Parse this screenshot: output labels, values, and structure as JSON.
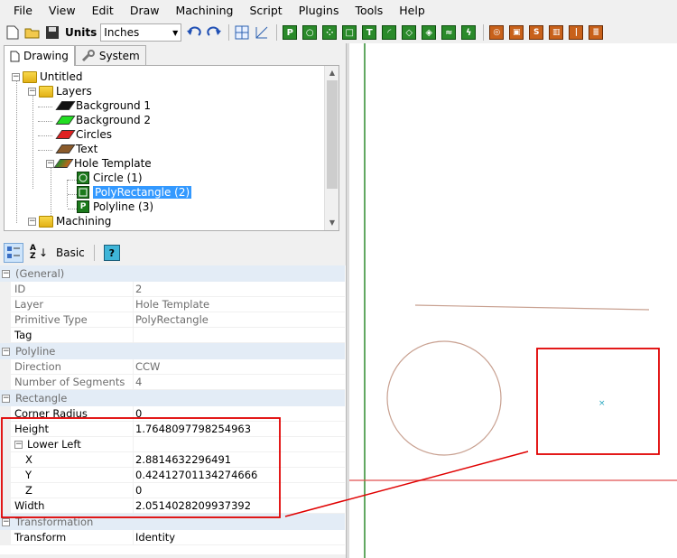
{
  "menu": [
    "File",
    "View",
    "Edit",
    "Draw",
    "Machining",
    "Script",
    "Plugins",
    "Tools",
    "Help"
  ],
  "toolbar": {
    "units_label": "Units",
    "units_value": "Inches"
  },
  "tabs": [
    {
      "label": "Drawing",
      "icon": "page-icon"
    },
    {
      "label": "System",
      "icon": "wrench-icon"
    }
  ],
  "tree": {
    "root": "Untitled",
    "layers": "Layers",
    "items": [
      "Background 1",
      "Background 2",
      "Circles",
      "Text"
    ],
    "hole_template": "Hole Template",
    "primitives": [
      "Circle (1)",
      "PolyRectangle (2)",
      "Polyline (3)"
    ],
    "machining": "Machining",
    "layer_colors": [
      "#111111",
      "#22dd22",
      "#e02020",
      "#8a5a2a"
    ]
  },
  "prop_toolbar": {
    "basic_label": "Basic",
    "help": "?",
    "sort_icon": "A Z"
  },
  "properties": {
    "general": "(General)",
    "id": {
      "name": "ID",
      "value": "2"
    },
    "layer": {
      "name": "Layer",
      "value": "Hole Template"
    },
    "primitive_type": {
      "name": "Primitive Type",
      "value": "PolyRectangle"
    },
    "tag": {
      "name": "Tag",
      "value": ""
    },
    "polyline": "Polyline",
    "direction": {
      "name": "Direction",
      "value": "CCW"
    },
    "segments": {
      "name": "Number of Segments",
      "value": "4"
    },
    "rectangle": "Rectangle",
    "corner_radius": {
      "name": "Corner Radius",
      "value": "0"
    },
    "height": {
      "name": "Height",
      "value": "1.7648097798254963"
    },
    "lower_left": "Lower Left",
    "x": {
      "name": "X",
      "value": "2.8814632296491"
    },
    "y": {
      "name": "Y",
      "value": "0.42412701134274666"
    },
    "z": {
      "name": "Z",
      "value": "0"
    },
    "width": {
      "name": "Width",
      "value": "2.0514028209937392"
    },
    "transformation": "Transformation",
    "transform": {
      "name": "Transform",
      "value": "Identity"
    }
  },
  "colors": {
    "selection": "#3399ff",
    "annotation": "#e00000",
    "axis_green": "#2e8b2e",
    "axis_red": "#e05050",
    "shape": "#c8a090"
  }
}
